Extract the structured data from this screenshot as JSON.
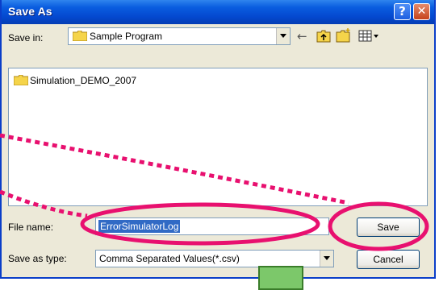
{
  "window": {
    "title": "Save As",
    "help_label": "?",
    "close_label": "✕"
  },
  "toolbar": {
    "save_in_label": "Save in:",
    "save_in_value": "Sample Program",
    "icons": [
      "back-arrow-icon",
      "up-folder-icon",
      "new-folder-icon",
      "view-menu-icon"
    ]
  },
  "file_list": {
    "items": [
      {
        "name": "Simulation_DEMO_2007",
        "icon": "folder-icon"
      }
    ]
  },
  "form": {
    "file_name_label": "File name:",
    "file_name_value": "ErrorSimulatorLog",
    "save_as_type_label": "Save as type:",
    "save_as_type_value": "Comma Separated Values(*.csv)"
  },
  "buttons": {
    "save_label": "Save",
    "cancel_label": "Cancel"
  },
  "colors": {
    "title_bar": "#0a5de0",
    "annotation": "#e8106f",
    "selection": "#316ac5"
  }
}
